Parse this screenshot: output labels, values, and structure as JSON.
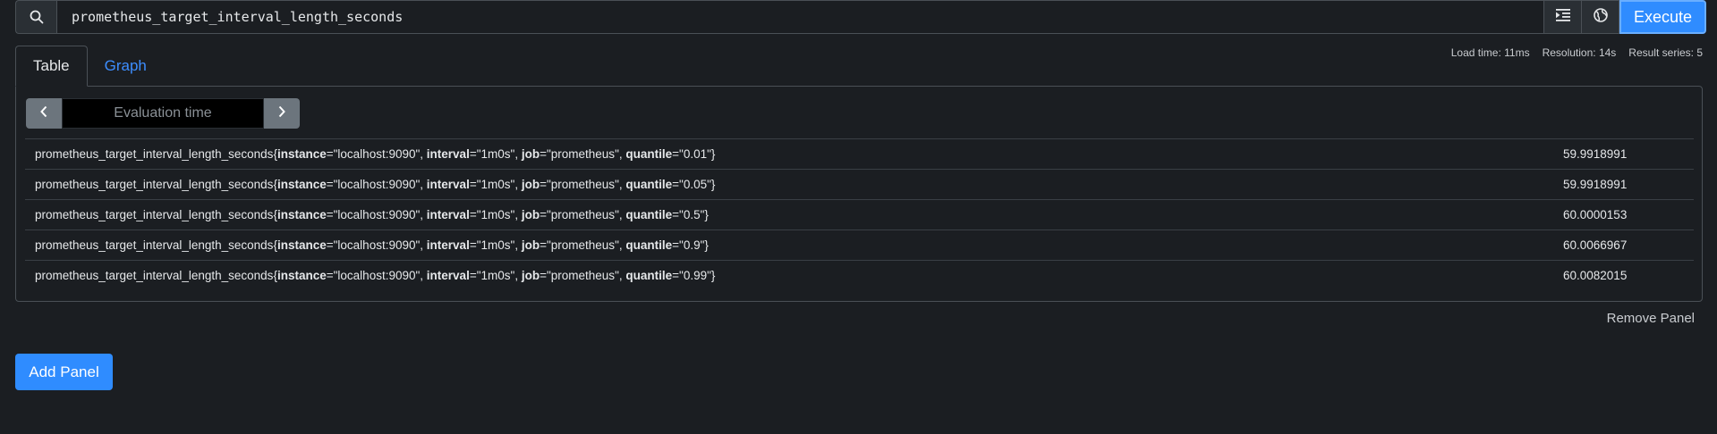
{
  "query": {
    "expression": "prometheus_target_interval_length_seconds",
    "search_icon": "search-icon",
    "format_icon": "format-indent-icon",
    "metrics_explorer_icon": "globe-icon",
    "execute_label": "Execute"
  },
  "stats": {
    "load_time": "Load time: 11ms",
    "resolution": "Resolution: 14s",
    "result_series": "Result series: 5"
  },
  "tabs": [
    {
      "label": "Table",
      "active": true
    },
    {
      "label": "Graph",
      "active": false
    }
  ],
  "eval": {
    "placeholder": "Evaluation time",
    "prev_icon": "chevron-left-icon",
    "next_icon": "chevron-right-icon"
  },
  "results": [
    {
      "metric": "prometheus_target_interval_length_seconds",
      "instance": "localhost:9090",
      "interval": "1m0s",
      "job": "prometheus",
      "quantile": "0.01",
      "value": "59.9918991"
    },
    {
      "metric": "prometheus_target_interval_length_seconds",
      "instance": "localhost:9090",
      "interval": "1m0s",
      "job": "prometheus",
      "quantile": "0.05",
      "value": "59.9918991"
    },
    {
      "metric": "prometheus_target_interval_length_seconds",
      "instance": "localhost:9090",
      "interval": "1m0s",
      "job": "prometheus",
      "quantile": "0.5",
      "value": "60.0000153"
    },
    {
      "metric": "prometheus_target_interval_length_seconds",
      "instance": "localhost:9090",
      "interval": "1m0s",
      "job": "prometheus",
      "quantile": "0.9",
      "value": "60.0066967"
    },
    {
      "metric": "prometheus_target_interval_length_seconds",
      "instance": "localhost:9090",
      "interval": "1m0s",
      "job": "prometheus",
      "quantile": "0.99",
      "value": "60.0082015"
    }
  ],
  "panel_actions": {
    "remove_label": "Remove Panel",
    "add_label": "Add Panel"
  },
  "colors": {
    "background": "#1b1e22",
    "accent": "#2f8cff",
    "link": "#3d8eff"
  }
}
